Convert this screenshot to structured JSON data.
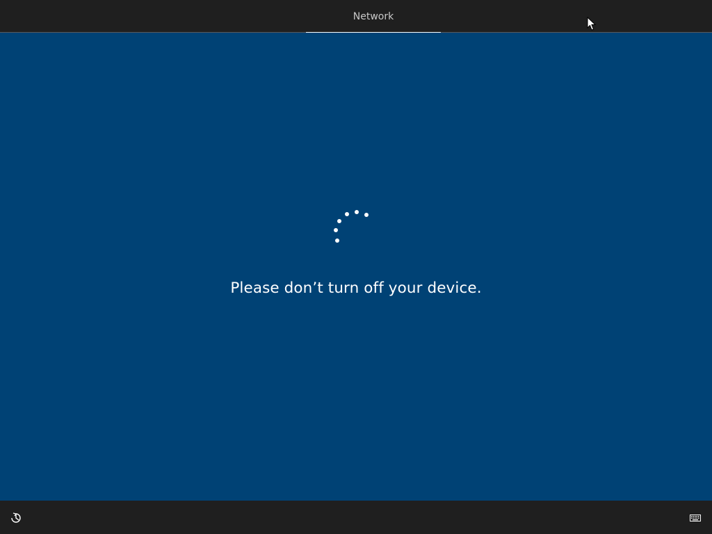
{
  "header": {
    "tabs": [
      {
        "label": "Network",
        "active": true
      }
    ]
  },
  "main": {
    "status_message": "Please don’t turn off your device.",
    "spinner_icon": "loading-spinner-icon",
    "background_color": "#004275"
  },
  "footer": {
    "left_icon": "ease-of-access-icon",
    "right_icon": "keyboard-icon"
  },
  "colors": {
    "bar_background": "#1f1f1f",
    "accent_underline": "#ffffff",
    "text_primary": "#ffffff",
    "tab_text": "#c9c9c9"
  }
}
